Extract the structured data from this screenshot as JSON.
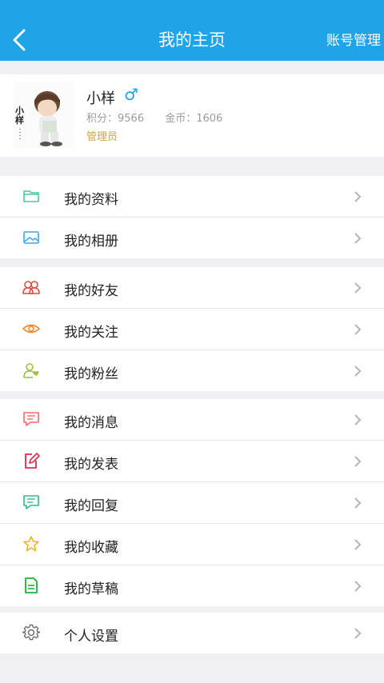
{
  "header": {
    "title": "我的主页",
    "account_manage": "账号管理"
  },
  "profile": {
    "avatar_caption": "小样",
    "name": "小样",
    "gender_symbol": "♂",
    "points_label": "积分：9566",
    "coins_label": "金币：1606",
    "role": "管理员"
  },
  "menu": {
    "g1": [
      {
        "label": "我的资料"
      },
      {
        "label": "我的相册"
      }
    ],
    "g2": [
      {
        "label": "我的好友"
      },
      {
        "label": "我的关注"
      },
      {
        "label": "我的粉丝"
      }
    ],
    "g3": [
      {
        "label": "我的消息"
      },
      {
        "label": "我的发表"
      },
      {
        "label": "我的回复"
      },
      {
        "label": "我的收藏"
      },
      {
        "label": "我的草稿"
      }
    ],
    "g4": [
      {
        "label": "个人设置"
      }
    ]
  },
  "colors": {
    "header": "#1fa4ea",
    "accent_role": "#d4a24a"
  }
}
